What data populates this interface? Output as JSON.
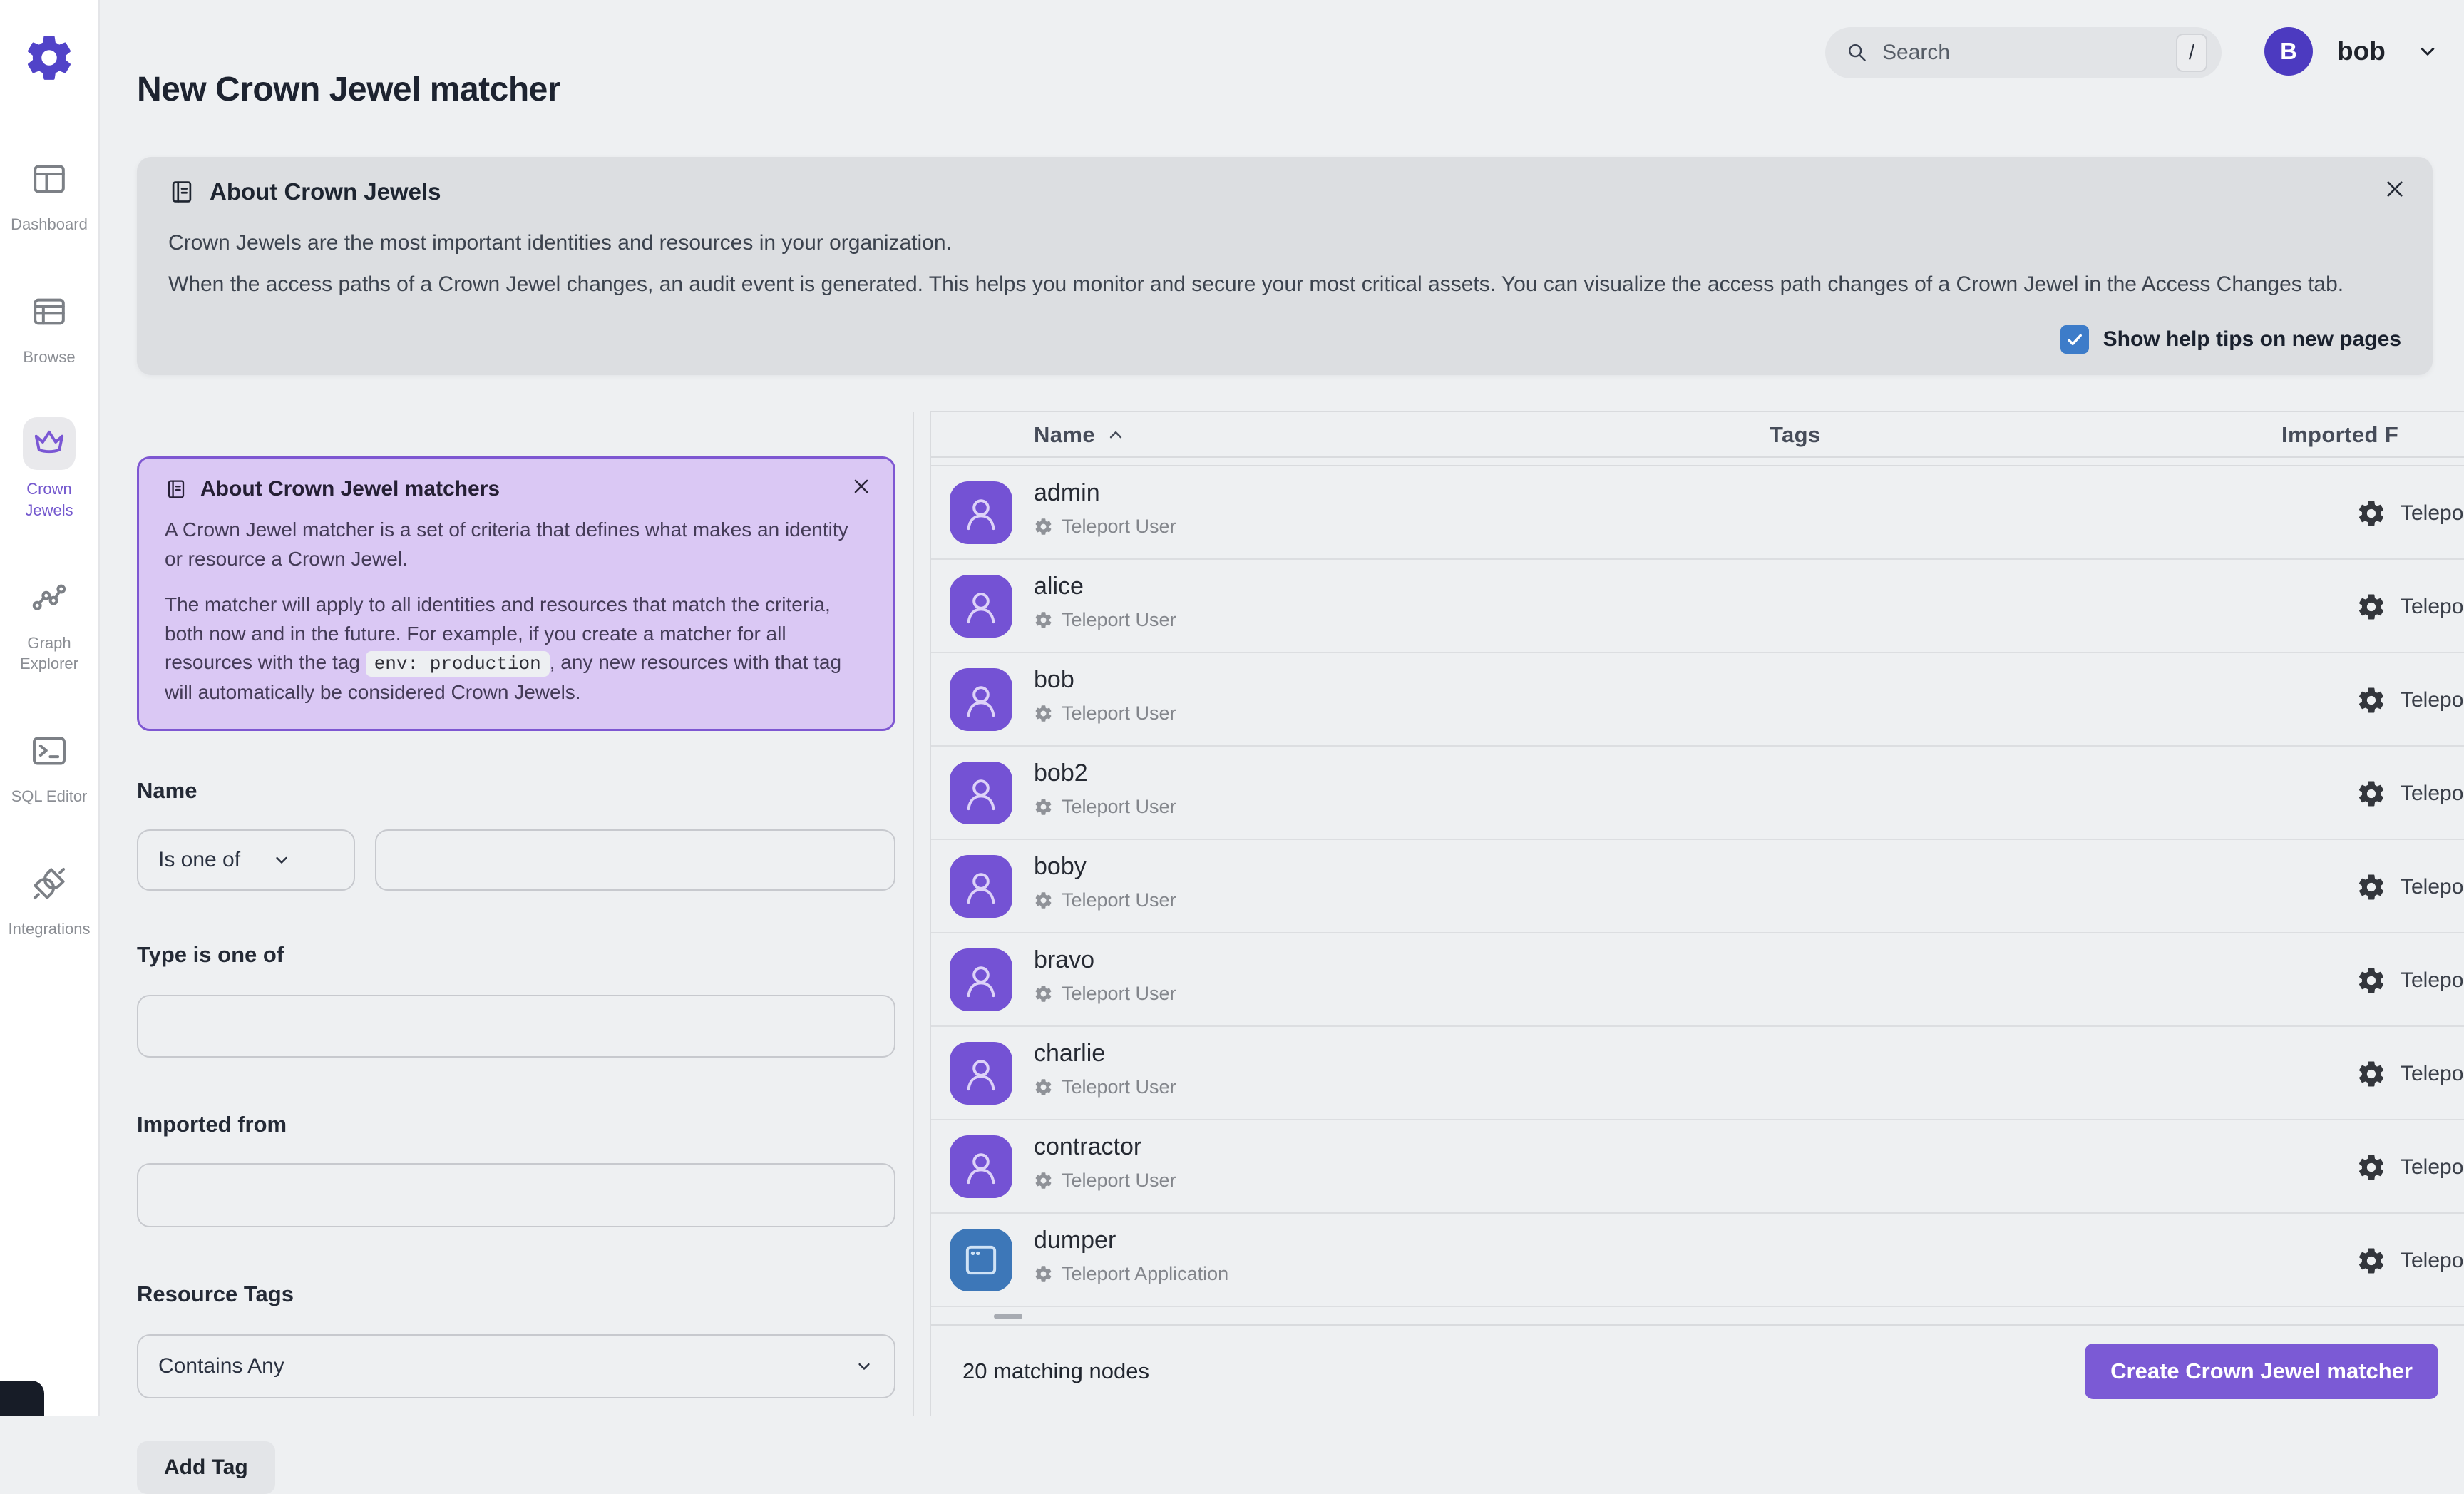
{
  "sidebar": {
    "items": [
      {
        "label": "Dashboard",
        "icon": "dashboard-icon",
        "active": false
      },
      {
        "label": "Browse",
        "icon": "browse-icon",
        "active": false
      },
      {
        "label": "Crown Jewels",
        "icon": "crown-icon",
        "active": true
      },
      {
        "label": "Graph Explorer",
        "icon": "graph-icon",
        "active": false
      },
      {
        "label": "SQL Editor",
        "icon": "terminal-icon",
        "active": false
      },
      {
        "label": "Integrations",
        "icon": "plug-icon",
        "active": false
      }
    ]
  },
  "topbar": {
    "search_placeholder": "Search",
    "search_shortcut": "/",
    "user_initial": "B",
    "user_name": "bob"
  },
  "page": {
    "title": "New Crown Jewel matcher"
  },
  "about_banner": {
    "title": "About Crown Jewels",
    "paragraph1": "Crown Jewels are the most important identities and resources in your organization.",
    "paragraph2": "When the access paths of a Crown Jewel changes, an audit event is generated. This helps you monitor and secure your most critical assets. You can visualize the access path changes of a Crown Jewel in the Access Changes tab.",
    "checkbox_label": "Show help tips on new pages",
    "checkbox_checked": true
  },
  "matcher_info": {
    "title": "About Crown Jewel matchers",
    "paragraph1": "A Crown Jewel matcher is a set of criteria that defines what makes an identity or resource a Crown Jewel.",
    "paragraph2_before": "The matcher will apply to all identities and resources that match the criteria, both now and in the future. For example, if you create a matcher for all resources with the tag ",
    "paragraph2_code": "env: production",
    "paragraph2_after": ", any new resources with that tag will automatically be considered Crown Jewels."
  },
  "form": {
    "name_label": "Name",
    "name_operator": "Is one of",
    "name_value": "",
    "type_label": "Type is one of",
    "type_value": "",
    "imported_label": "Imported from",
    "imported_value": "",
    "tags_label": "Resource Tags",
    "tags_operator": "Contains Any",
    "add_tag_label": "Add Tag"
  },
  "table": {
    "columns": [
      {
        "label": "Name",
        "sorted": "asc"
      },
      {
        "label": "Tags",
        "sorted": null
      },
      {
        "label": "Imported F",
        "sorted": null
      }
    ],
    "rows": [
      {
        "name": "admin",
        "type": "Teleport User",
        "icon": "user",
        "imported": "Telepo"
      },
      {
        "name": "alice",
        "type": "Teleport User",
        "icon": "user",
        "imported": "Telepo"
      },
      {
        "name": "bob",
        "type": "Teleport User",
        "icon": "user",
        "imported": "Telepo"
      },
      {
        "name": "bob2",
        "type": "Teleport User",
        "icon": "user",
        "imported": "Telepo"
      },
      {
        "name": "boby",
        "type": "Teleport User",
        "icon": "user",
        "imported": "Telepo"
      },
      {
        "name": "bravo",
        "type": "Teleport User",
        "icon": "user",
        "imported": "Telepo"
      },
      {
        "name": "charlie",
        "type": "Teleport User",
        "icon": "user",
        "imported": "Telepo"
      },
      {
        "name": "contractor",
        "type": "Teleport User",
        "icon": "user",
        "imported": "Telepo"
      },
      {
        "name": "dumper",
        "type": "Teleport Application",
        "icon": "app",
        "imported": "Telepo"
      }
    ],
    "footer": {
      "count_text": "20 matching nodes",
      "create_button": "Create Crown Jewel matcher"
    }
  },
  "colors": {
    "accent": "#7b5ad5",
    "logo": "#5143c8",
    "checkbox_blue": "#3d7cc9",
    "avatar_user": "#7452d4",
    "avatar_app": "#3d77b8",
    "user_badge": "#4c3ac0"
  }
}
